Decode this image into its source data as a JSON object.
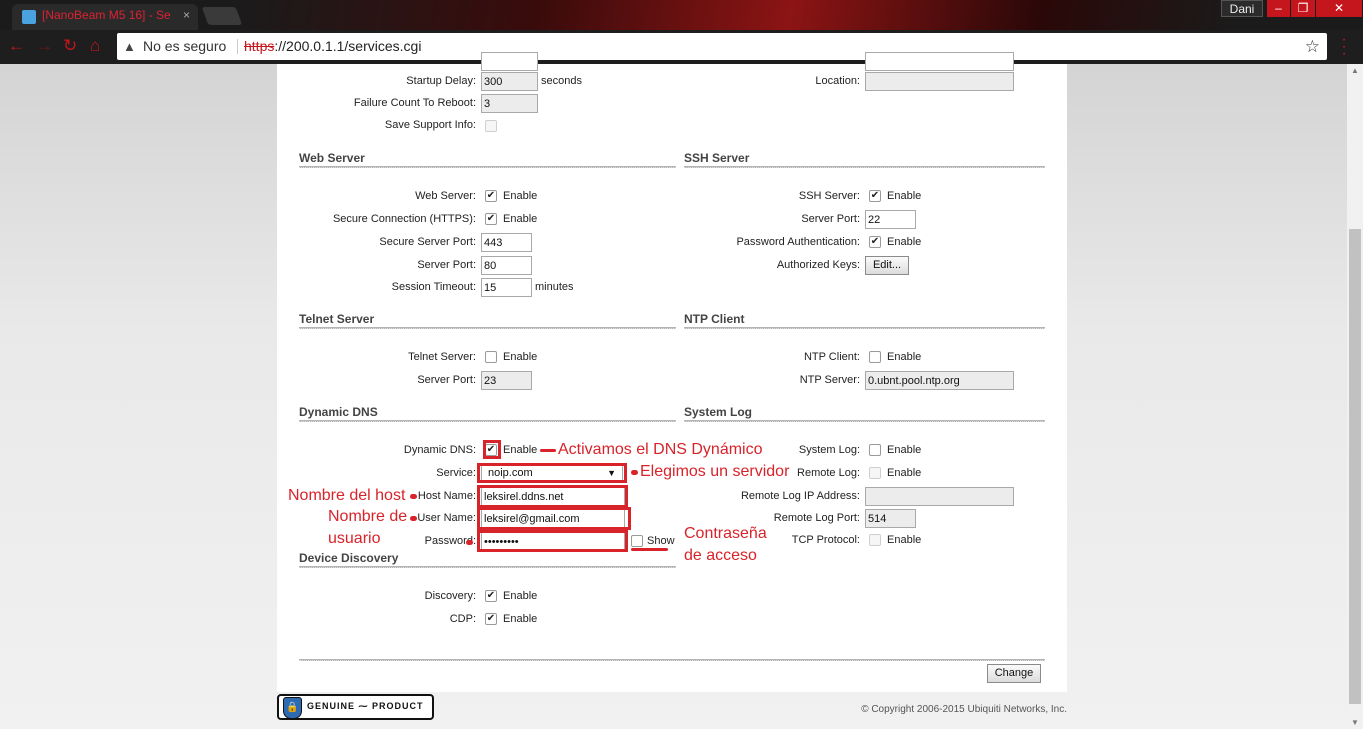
{
  "browser": {
    "tab_title": "[NanoBeam M5 16] - Se",
    "tab_close": "×",
    "user_name": "Dani",
    "win_minimize": "–",
    "win_maximize": "❐",
    "win_close": "✕",
    "security_label": "No es seguro",
    "url_scheme": "https",
    "url_rest": "://200.0.1.1/services.cgi",
    "icons": [
      "back-arrow-icon",
      "forward-arrow-icon",
      "reload-icon",
      "home-icon",
      "warning-icon",
      "star-icon",
      "menu-dots-icon"
    ]
  },
  "colors": {
    "accent": "#c4161c",
    "annotation": "#d8232a",
    "panel": "#ffffff"
  },
  "top_section": {
    "startup_delay_label": "Startup Delay:",
    "startup_delay_value": "300",
    "startup_delay_unit": "seconds",
    "failure_count_label": "Failure Count To Reboot:",
    "failure_count_value": "3",
    "save_support_label": "Save Support Info:",
    "location_label": "Location:",
    "location_value": ""
  },
  "web_server": {
    "title": "Web Server",
    "web_server_label": "Web Server:",
    "web_server_enabled": true,
    "secure_label": "Secure Connection (HTTPS):",
    "secure_enabled": true,
    "secure_port_label": "Secure Server Port:",
    "secure_port_value": "443",
    "server_port_label": "Server Port:",
    "server_port_value": "80",
    "timeout_label": "Session Timeout:",
    "timeout_value": "15",
    "timeout_unit": "minutes"
  },
  "ssh_server": {
    "title": "SSH Server",
    "ssh_label": "SSH Server:",
    "ssh_enabled": true,
    "port_label": "Server Port:",
    "port_value": "22",
    "pwd_auth_label": "Password Authentication:",
    "pwd_auth_enabled": true,
    "keys_label": "Authorized Keys:",
    "edit_button": "Edit..."
  },
  "telnet_server": {
    "title": "Telnet Server",
    "telnet_label": "Telnet Server:",
    "telnet_enabled": false,
    "port_label": "Server Port:",
    "port_value": "23"
  },
  "ntp_client": {
    "title": "NTP Client",
    "ntp_label": "NTP Client:",
    "ntp_enabled": false,
    "server_label": "NTP Server:",
    "server_value": "0.ubnt.pool.ntp.org"
  },
  "dynamic_dns": {
    "title": "Dynamic DNS",
    "ddns_label": "Dynamic DNS:",
    "ddns_enabled": true,
    "service_label": "Service:",
    "service_value": "noip.com",
    "host_label": "Host Name:",
    "host_value": "leksirel.ddns.net",
    "user_label": "User Name:",
    "user_value": "leksirel@gmail.com",
    "password_label": "Password:",
    "password_value": "•••••••••",
    "show_label": "Show"
  },
  "system_log": {
    "title": "System Log",
    "syslog_label": "System Log:",
    "remote_log_label": "Remote Log:",
    "remote_ip_label": "Remote Log IP Address:",
    "remote_ip_value": "",
    "remote_port_label": "Remote Log Port:",
    "remote_port_value": "514",
    "tcp_label": "TCP Protocol:"
  },
  "device_discovery": {
    "title": "Device Discovery",
    "discovery_label": "Discovery:",
    "discovery_enabled": true,
    "cdp_label": "CDP:",
    "cdp_enabled": true
  },
  "common": {
    "enable_label": "Enable",
    "check_mark": "✔"
  },
  "change_button": "Change",
  "annotations": {
    "activate_ddns": "Activamos el DNS Dynámico",
    "choose_server": "Elegimos un servidor",
    "host_name": "Nombre del host",
    "user_name_line1": "Nombre de",
    "user_name_line2": "usuario",
    "password_line1": "Contraseña",
    "password_line2": "de acceso"
  },
  "footer": {
    "badge_text": "GENUINE ⁓ PRODUCT",
    "copyright": "© Copyright 2006-2015 Ubiquiti Networks, Inc."
  }
}
